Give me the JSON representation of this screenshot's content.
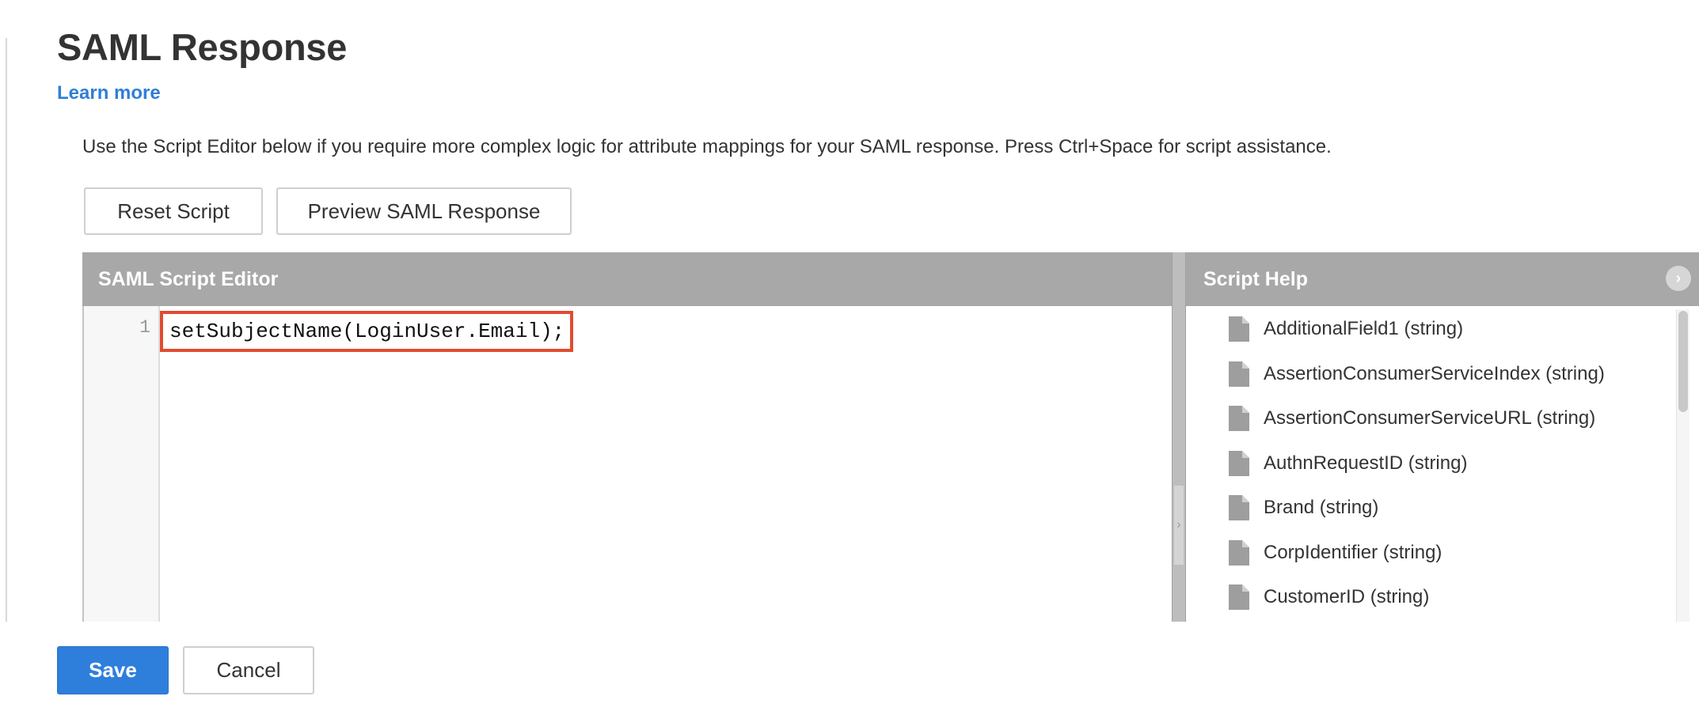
{
  "page": {
    "title": "SAML Response",
    "learn_more": "Learn more",
    "description": "Use the Script Editor below if you require more complex logic for attribute mappings for your SAML response. Press Ctrl+Space for script assistance."
  },
  "toolbar": {
    "reset_label": "Reset Script",
    "preview_label": "Preview SAML Response"
  },
  "editor": {
    "title": "SAML Script Editor",
    "line_number": "1",
    "code": "setSubjectName(LoginUser.Email);",
    "highlight_color": "#e24b2f"
  },
  "help": {
    "title": "Script Help",
    "collapse_icon": "chevron-right-circle-icon",
    "item_icon": "document-icon",
    "items": [
      "AdditionalField1 (string)",
      "AssertionConsumerServiceIndex (string)",
      "AssertionConsumerServiceURL (string)",
      "AuthnRequestID (string)",
      "Brand (string)",
      "CorpIdentifier (string)",
      "CustomerID (string)"
    ]
  },
  "footer": {
    "save_label": "Save",
    "cancel_label": "Cancel",
    "primary_color": "#2e7fdc"
  }
}
